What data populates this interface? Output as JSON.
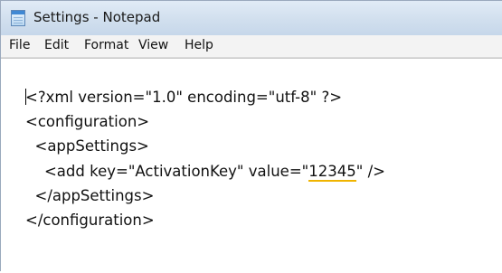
{
  "window": {
    "title": "Settings - Notepad",
    "icon": "notepad-icon"
  },
  "menu": [
    {
      "label": "File"
    },
    {
      "label": "Edit"
    },
    {
      "label": "Format"
    },
    {
      "label": "View"
    },
    {
      "label": "Help"
    }
  ],
  "document": {
    "lines": [
      "<?xml version=\"1.0\" encoding=\"utf-8\" ?>",
      "<configuration>",
      "  <appSettings>",
      "    <add key=\"ActivationKey\" value=\"",
      "  </appSettings>",
      "</configuration>"
    ],
    "value_highlight": "12345",
    "line4_tail": "\" />",
    "highlight_color": "#f0b400"
  }
}
